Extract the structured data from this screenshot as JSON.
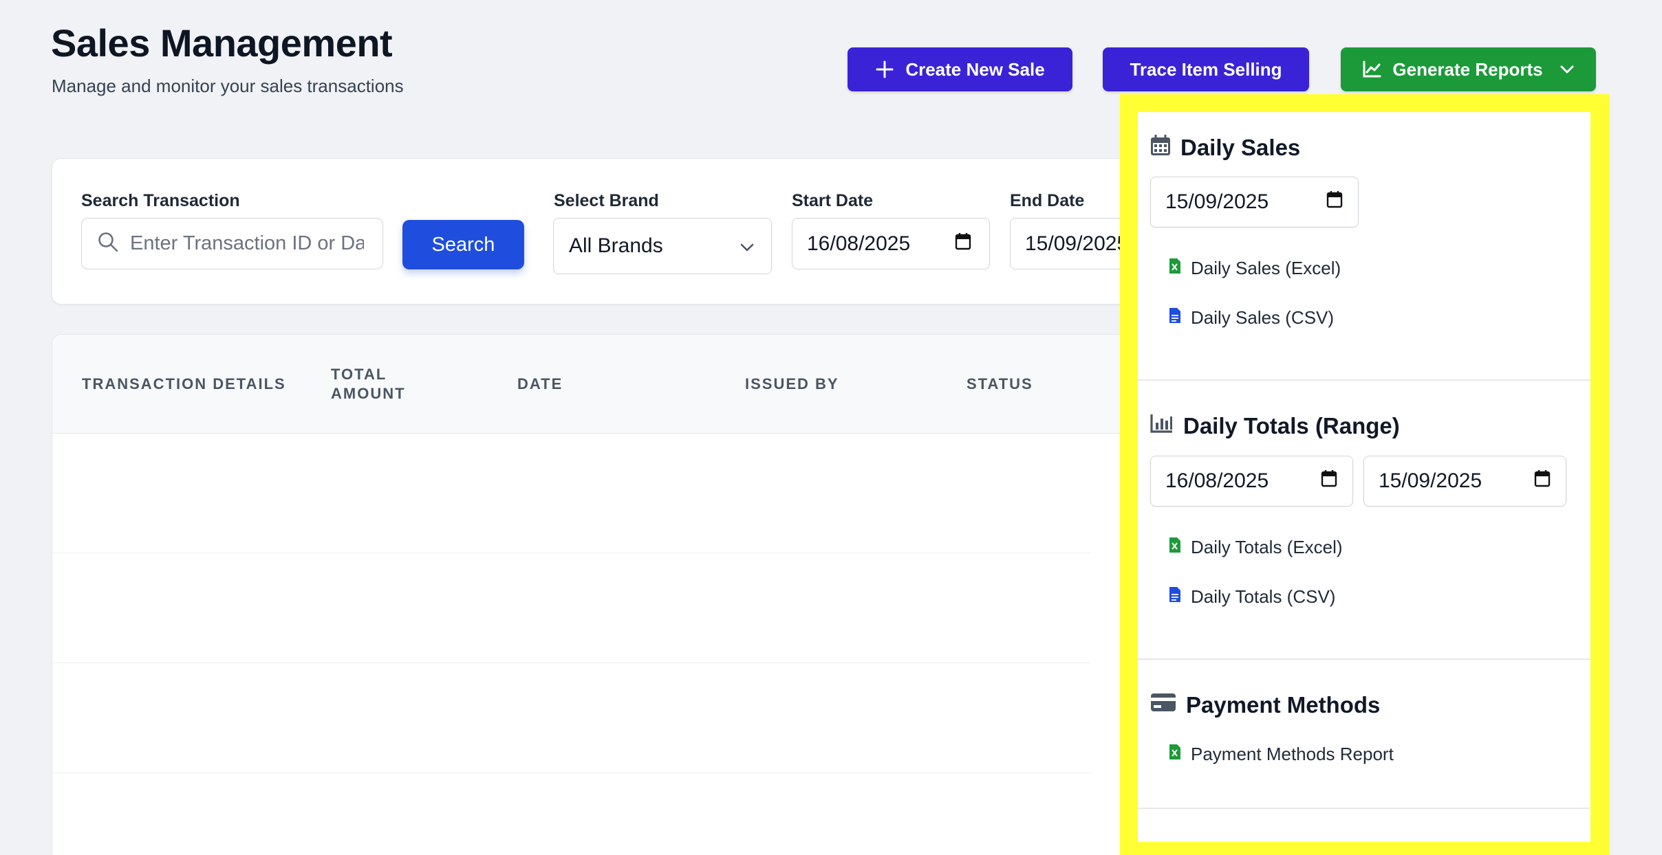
{
  "header": {
    "title": "Sales Management",
    "subtitle": "Manage and monitor your sales transactions"
  },
  "actions": {
    "create_label": "Create New Sale",
    "trace_label": "Trace Item Selling",
    "reports_label": "Generate Reports"
  },
  "filters": {
    "search_label": "Search Transaction",
    "search_placeholder": "Enter Transaction ID or Date",
    "search_button": "Search",
    "brand_label": "Select Brand",
    "brand_value": "All Brands",
    "start_label": "Start Date",
    "start_value": "16/08/2025",
    "end_label": "End Date",
    "end_value": "15/09/2025"
  },
  "table": {
    "columns": [
      "TRANSACTION DETAILS",
      "TOTAL AMOUNT",
      "DATE",
      "ISSUED BY",
      "STATUS"
    ]
  },
  "reports_menu": {
    "daily_sales": {
      "title": "Daily Sales",
      "date": "15/09/2025",
      "excel": "Daily Sales (Excel)",
      "csv": "Daily Sales (CSV)"
    },
    "daily_totals": {
      "title": "Daily Totals (Range)",
      "start": "16/08/2025",
      "end": "15/09/2025",
      "excel": "Daily Totals (Excel)",
      "csv": "Daily Totals (CSV)"
    },
    "payment_methods": {
      "title": "Payment Methods",
      "report": "Payment Methods Report"
    }
  },
  "colors": {
    "primary": "#3a23d6",
    "search_blue": "#1f4ede",
    "reports_green": "#1c9a3a",
    "highlight": "#ffff33"
  },
  "icons": [
    "plus-icon",
    "trend-chart-icon",
    "chevron-down-icon",
    "search-icon",
    "calendar-icon",
    "bar-chart-icon",
    "credit-card-icon",
    "excel-file-icon",
    "csv-file-icon"
  ]
}
